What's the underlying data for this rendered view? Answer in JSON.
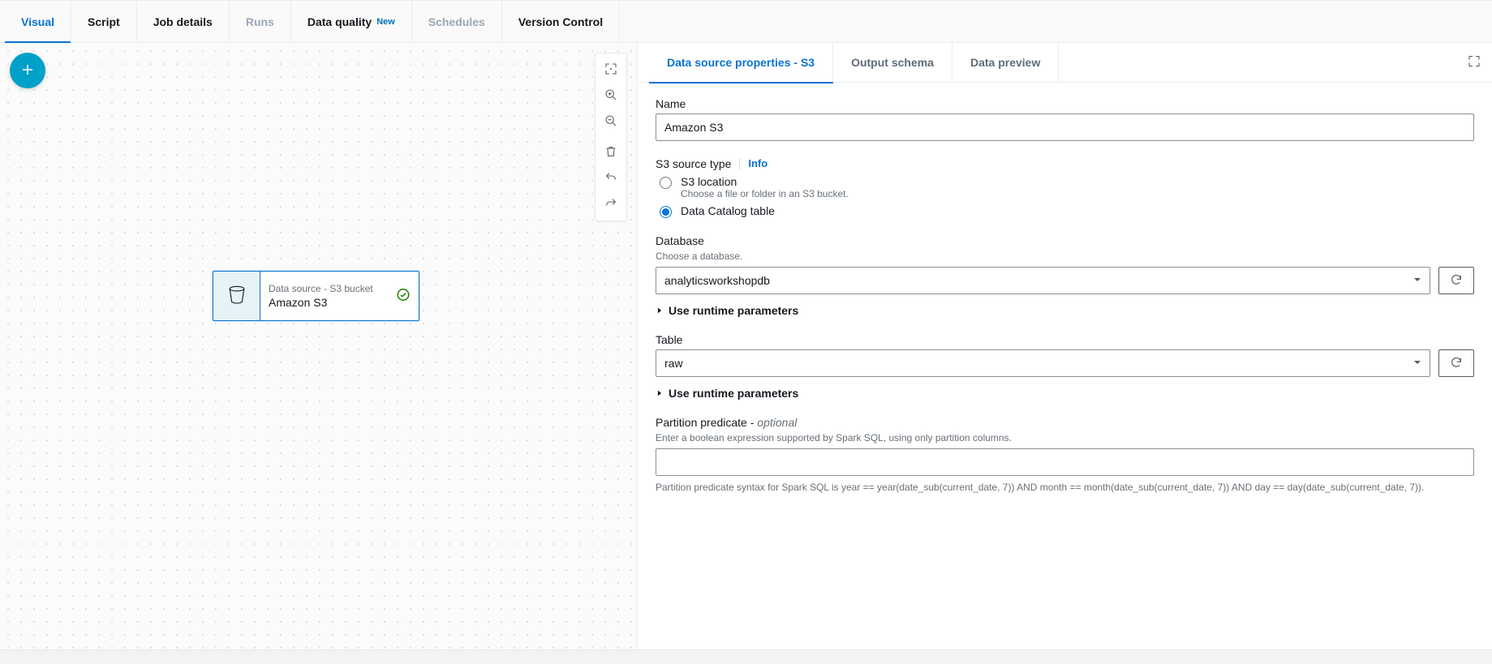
{
  "topTabs": {
    "visual": "Visual",
    "script": "Script",
    "jobDetails": "Job details",
    "runs": "Runs",
    "dataQuality": "Data quality",
    "dataQualityBadge": "New",
    "schedules": "Schedules",
    "versionControl": "Version Control"
  },
  "canvas": {
    "node": {
      "type": "Data source - S3 bucket",
      "name": "Amazon S3"
    }
  },
  "panelTabs": {
    "props": "Data source properties - S3",
    "outputSchema": "Output schema",
    "dataPreview": "Data preview"
  },
  "form": {
    "nameLabel": "Name",
    "nameValue": "Amazon S3",
    "sourceTypeLabel": "S3 source type",
    "infoLink": "Info",
    "radioS3Location": "S3 location",
    "radioS3LocationDesc": "Choose a file or folder in an S3 bucket.",
    "radioCatalog": "Data Catalog table",
    "databaseLabel": "Database",
    "databaseDesc": "Choose a database.",
    "databaseValue": "analyticsworkshopdb",
    "runtimeParamsLabel": "Use runtime parameters",
    "tableLabel": "Table",
    "tableValue": "raw",
    "partitionLabel": "Partition predicate - ",
    "partitionOptional": "optional",
    "partitionDesc": "Enter a boolean expression supported by Spark SQL, using only partition columns.",
    "partitionValue": "",
    "partitionHint": "Partition predicate syntax for Spark SQL is year == year(date_sub(current_date, 7)) AND month == month(date_sub(current_date, 7)) AND day == day(date_sub(current_date, 7))."
  }
}
